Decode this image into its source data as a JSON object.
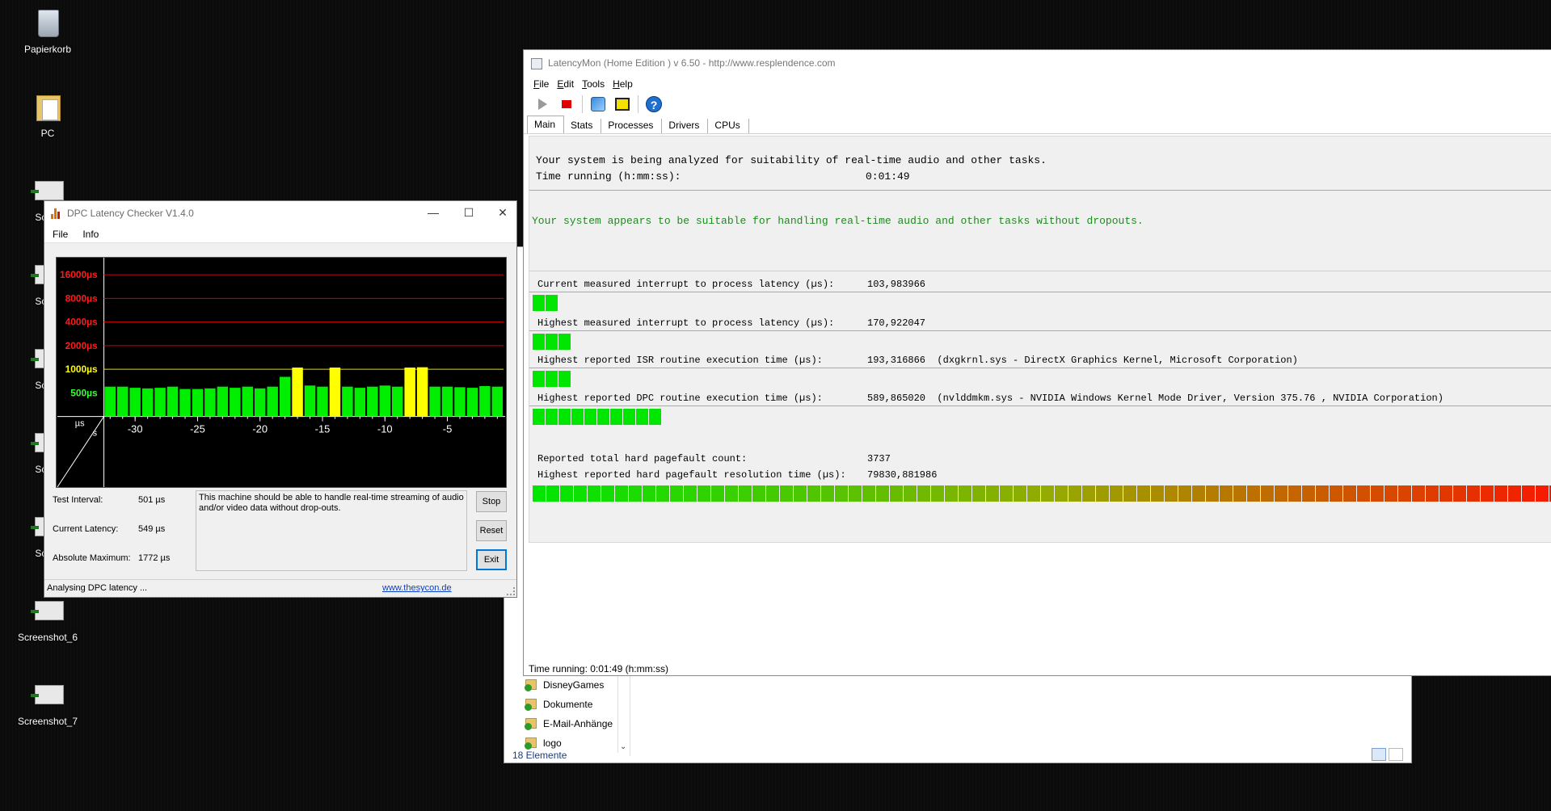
{
  "desktop": {
    "icons": [
      {
        "label": "Papierkorb",
        "kind": "bin"
      },
      {
        "label": "PC",
        "kind": "pc"
      },
      {
        "label": "Scree",
        "kind": "shot"
      },
      {
        "label": "Scree",
        "kind": "shot"
      },
      {
        "label": "Scree",
        "kind": "shot"
      },
      {
        "label": "Scree",
        "kind": "shot"
      },
      {
        "label": "Scree",
        "kind": "shot"
      },
      {
        "label": "Screenshot_6",
        "kind": "shot"
      },
      {
        "label": "Screenshot_7",
        "kind": "shot"
      }
    ]
  },
  "explorer": {
    "items": [
      "DisneyGames",
      "Dokumente",
      "E-Mail-Anhänge",
      "logo"
    ],
    "status": "18 Elemente"
  },
  "latencymon": {
    "title": "LatencyMon  (Home Edition )  v 6.50 - http://www.resplendence.com",
    "menu": [
      "File",
      "Edit",
      "Tools",
      "Help"
    ],
    "tabs": [
      "Main",
      "Stats",
      "Processes",
      "Drivers",
      "CPUs"
    ],
    "active_tab": "Main",
    "analyzing_text": "Your system is being analyzed for suitability of real-time audio and other tasks.",
    "time_label": "Time running (h:mm:ss):",
    "time_value": "0:01:49",
    "verdict": "Your system appears to be suitable for handling real-time audio and other tasks without dropouts.",
    "verdict_color": "#1f8a1f",
    "metrics": [
      {
        "label": "Current measured interrupt to process latency (µs):",
        "value": "103,983966",
        "bar_fraction": 0.014
      },
      {
        "label": "Highest measured interrupt to process latency (µs):",
        "value": "170,922047",
        "bar_fraction": 0.023
      },
      {
        "label": "Highest reported ISR routine execution time (µs):",
        "value": "193,316866  (dxgkrnl.sys - DirectX Graphics Kernel, Microsoft Corporation)",
        "bar_fraction": 0.026
      },
      {
        "label": "Highest reported DPC routine execution time (µs):",
        "value": "589,865020  (nvlddmkm.sys - NVIDIA Windows Kernel Mode Driver, Version 375.76 , NVIDIA Corporation)",
        "bar_fraction": 0.079
      }
    ],
    "pagefault_count_label": "Reported total hard pagefault count:",
    "pagefault_count_value": "3737",
    "pagefault_time_label": "Highest reported hard pagefault resolution time (µs):",
    "pagefault_time_value": "79830,881986",
    "pagefault_bar_fraction": 1.0,
    "status": "Time running: 0:01:49  (h:mm:ss)"
  },
  "dpc": {
    "title": "DPC Latency Checker V1.4.0",
    "menu": [
      "File",
      "Info"
    ],
    "ylabels": [
      {
        "text": "16000µs",
        "color": "#ff1a1a"
      },
      {
        "text": "8000µs",
        "color": "#ff1a1a"
      },
      {
        "text": "4000µs",
        "color": "#ff1a1a"
      },
      {
        "text": "2000µs",
        "color": "#ff1a1a"
      },
      {
        "text": "1000µs",
        "color": "#ffff00"
      },
      {
        "text": "500µs",
        "color": "#33ff33"
      }
    ],
    "corner_top": "µs",
    "corner_bottom": "s",
    "xticks": [
      "-30",
      "-25",
      "-20",
      "-15",
      "-10",
      "-5"
    ],
    "chart_data": {
      "type": "bar",
      "xlabel": "s",
      "ylabel": "µs",
      "x": [
        -32,
        -31,
        -30,
        -29,
        -28,
        -27,
        -26,
        -25,
        -24,
        -23,
        -22,
        -21,
        -20,
        -19,
        -18,
        -17,
        -16,
        -15,
        -14,
        -13,
        -12,
        -11,
        -10,
        -9,
        -8,
        -7,
        -6,
        -5,
        -4,
        -3,
        -2,
        -1
      ],
      "values": [
        600,
        600,
        580,
        570,
        580,
        600,
        560,
        560,
        570,
        600,
        580,
        600,
        570,
        600,
        800,
        1050,
        620,
        600,
        1050,
        600,
        580,
        600,
        620,
        600,
        1050,
        1060,
        600,
        600,
        590,
        580,
        610,
        600
      ],
      "scale": "log2",
      "gridlines": [
        16000,
        8000,
        4000,
        2000,
        1000
      ],
      "threshold": 1000
    },
    "info": [
      {
        "label": "Test Interval:",
        "value": "501 µs"
      },
      {
        "label": "Current Latency:",
        "value": "549 µs"
      },
      {
        "label": "Absolute Maximum:",
        "value": "1772 µs"
      }
    ],
    "message": "This machine should be able to handle real-time streaming of audio and/or video data without drop-outs.",
    "buttons": {
      "stop": "Stop",
      "reset": "Reset",
      "exit": "Exit"
    },
    "status": "Analysing DPC latency ...",
    "link": "www.thesycon.de"
  }
}
